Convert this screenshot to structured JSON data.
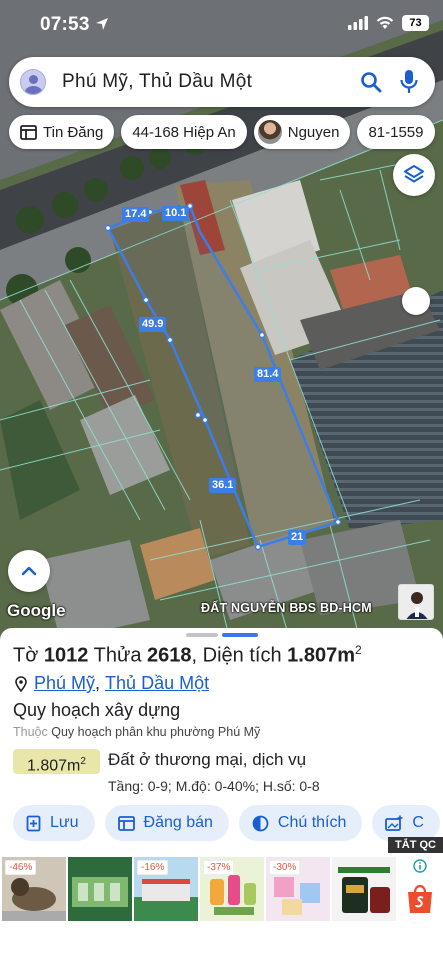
{
  "status": {
    "time": "07:53",
    "battery": "73"
  },
  "search": {
    "text": "Phú Mỹ, Thủ Dầu Một"
  },
  "chips": [
    {
      "label": "Tin Đăng",
      "icon": "listing-icon"
    },
    {
      "label": "44-168 Hiệp An",
      "icon": ""
    },
    {
      "label": "Nguyen",
      "icon": "user-photo"
    },
    {
      "label": "81-1559",
      "icon": ""
    }
  ],
  "measurements": [
    "17.4",
    "10.1",
    "49.9",
    "81.4",
    "36.1",
    "21"
  ],
  "map": {
    "logo": "Google",
    "watermark": "ĐẤT NGUYỄN BĐS BD-HCM"
  },
  "parcel": {
    "to_label": "Tờ",
    "to_value": "1012",
    "thua_label": "Thửa",
    "thua_value": "2618",
    "area_label": "Diện tích",
    "area_value": "1.807m",
    "area_unit_sup": "2",
    "ward": "Phú Mỹ",
    "city": "Thủ Dầu Một",
    "plan_title": "Quy hoạch xây dựng",
    "plan_sub_prefix": "Thuộc",
    "plan_sub": "Quy hoạch phân khu phường Phú Mỹ",
    "badge_area": "1.807m",
    "badge_sup": "2",
    "land_use": "Đất ở thương mại, dịch vụ",
    "params": "Tầng: 0-9; M.độ: 0-40%; H.số: 0-8"
  },
  "actions": [
    {
      "label": "Lưu",
      "icon": "bookmark-plus-icon"
    },
    {
      "label": "Đăng bán",
      "icon": "listing-icon"
    },
    {
      "label": "Chú thích",
      "icon": "contrast-icon"
    },
    {
      "label": "C",
      "icon": "add-photo-icon"
    }
  ],
  "ads": {
    "close_label": "TẮT QC",
    "items": [
      {
        "discount": "-46%",
        "color": "#6d5a45"
      },
      {
        "discount": "",
        "color": "#2e6b3c"
      },
      {
        "discount": "-16%",
        "color": "#5d9ad0"
      },
      {
        "discount": "-37%",
        "color": "#a7c960"
      },
      {
        "discount": "-30%",
        "color": "#e8d6e8"
      },
      {
        "discount": "",
        "color": "#2b3f2b"
      }
    ]
  },
  "colors": {
    "accent": "#1a5fd1",
    "boundary": "#3d7ee6",
    "badge": "#e8e6a8"
  }
}
